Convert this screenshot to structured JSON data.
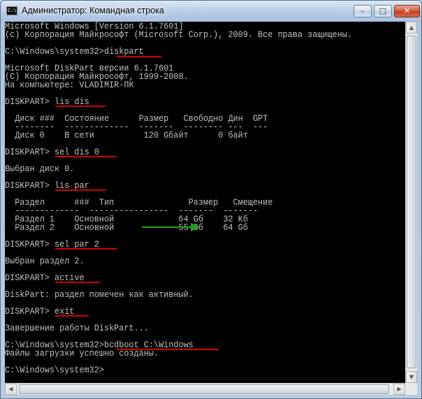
{
  "window": {
    "title": "Администратор: Командная строка",
    "icon_text": "C:\\",
    "controls": {
      "minimize": "–",
      "maximize": "□",
      "close": "✕"
    }
  },
  "console": {
    "lines": [
      "Microsoft Windows [Version 6.1.7601]",
      "(c) Корпорация Майкрософт (Microsoft Corp.), 2009. Все права защищены.",
      "",
      "C:\\Windows\\system32>diskpart",
      "",
      "Microsoft DiskPart версии 6.1.7601",
      "(C) Корпорация Майкрософт, 1999-2008.",
      "На компьютере: VLADIMIR-ПК",
      "",
      "DISKPART> lis dis",
      "",
      "  Диск ###  Состояние      Размер   Свободно Дин  GPT",
      "  --------  -------------  -------  -------- ---  ---",
      "  Диск 0    В сети          120 Gбайт      0 байт",
      "",
      "DISKPART> sel dis 0",
      "",
      "Выбран диск 0.",
      "",
      "DISKPART> lis par",
      "",
      "  Раздел      ###  Тип               Размер   Смещение",
      "  -------------  ----------------  -------  -------",
      "  Раздел 1    Основной             64 Gб    32 Kб",
      "  Раздел 2    Основной             55 Gб    64 Gб",
      "",
      "DISKPART> sel par 2",
      "",
      "Выбран раздел 2.",
      "",
      "DISKPART> active",
      "",
      "DiskPart: раздел помечен как активный.",
      "",
      "DISKPART> exit",
      "",
      "Завершение работы DiskPart...",
      "",
      "C:\\Windows\\system32>bcdboot C:\\Windows",
      "Файлы загрузки успешно созданы.",
      "",
      "C:\\Windows\\system32>"
    ],
    "highlighted_commands": [
      "diskpart",
      "lis dis",
      "sel dis 0",
      "lis par",
      "sel par 2",
      "active",
      "exit",
      "bcdboot C:\\Windows"
    ]
  },
  "colors": {
    "console_bg": "#000000",
    "console_text": "#c0c0c0",
    "underline": "#d40000",
    "arrow": "#21a121"
  },
  "icons": {
    "title": "cmd-icon",
    "annotation": "green-arrow-icon"
  }
}
